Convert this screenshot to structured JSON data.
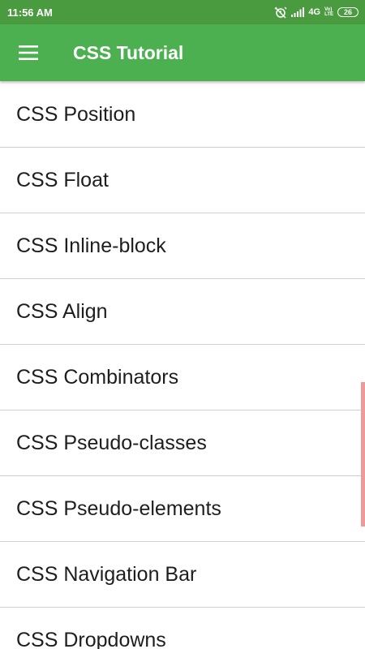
{
  "status_bar": {
    "time": "11:56 AM",
    "network": "4G",
    "volte_top": "Vo)",
    "volte_bottom": "LTE",
    "battery": "26"
  },
  "app_bar": {
    "title": "CSS Tutorial"
  },
  "list": {
    "items": [
      "CSS Position",
      "CSS Float",
      "CSS Inline-block",
      "CSS Align",
      "CSS Combinators",
      "CSS Pseudo-classes",
      "CSS Pseudo-elements",
      "CSS Navigation Bar",
      "CSS Dropdowns"
    ]
  },
  "colors": {
    "status_bar": "#4a9b3f",
    "app_bar": "#4caf50",
    "scroll_thumb": "#ef9a9a"
  },
  "icons": {
    "menu": "hamburger-menu-icon",
    "alarm": "alarm-off-icon",
    "signal": "signal-icon",
    "battery": "battery-icon"
  }
}
